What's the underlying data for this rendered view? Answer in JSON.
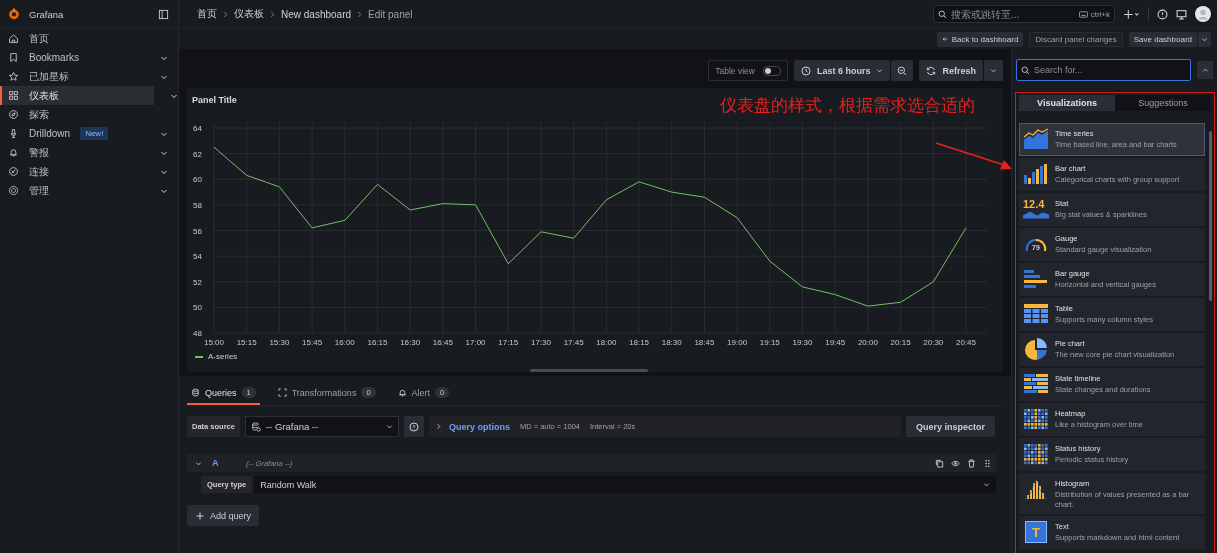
{
  "app": {
    "name": "Grafana"
  },
  "breadcrumbs": [
    {
      "label": "首页",
      "current": false
    },
    {
      "label": "仪表板",
      "current": false
    },
    {
      "label": "New dashboard",
      "current": false
    },
    {
      "label": "Edit panel",
      "current": true
    }
  ],
  "search": {
    "placeholder": "搜索或跳转至...",
    "shortcut": "ctrl+k"
  },
  "sidebar": {
    "items": [
      {
        "label": "首页",
        "selected": false,
        "submenu": false
      },
      {
        "label": "Bookmarks",
        "selected": false,
        "submenu": true
      },
      {
        "label": "已加星标",
        "selected": false,
        "submenu": true
      },
      {
        "label": "仪表板",
        "selected": true,
        "submenu": true
      },
      {
        "label": "探索",
        "selected": false,
        "submenu": false
      },
      {
        "label": "Drilldown",
        "selected": false,
        "submenu": true,
        "badge": "New!"
      },
      {
        "label": "警报",
        "selected": false,
        "submenu": true
      },
      {
        "label": "连接",
        "selected": false,
        "submenu": true
      },
      {
        "label": "管理",
        "selected": false,
        "submenu": true
      }
    ]
  },
  "actions": [
    {
      "label": "Back to dashboard",
      "kind": "back"
    },
    {
      "label": "Discard panel changes",
      "kind": "plain"
    },
    {
      "label": "Save dashboard",
      "kind": "split"
    }
  ],
  "toolbar": {
    "table_view": {
      "label": "Table view",
      "on": false
    },
    "time_range": "Last 6 hours",
    "refresh": "Refresh"
  },
  "panel": {
    "title": "Panel Title",
    "chart_data": {
      "type": "line",
      "grid": true,
      "x": [
        "15:00",
        "15:15",
        "15:30",
        "15:45",
        "16:00",
        "16:15",
        "16:30",
        "16:45",
        "17:00",
        "17:15",
        "17:30",
        "17:45",
        "18:00",
        "18:15",
        "18:30",
        "18:45",
        "19:00",
        "19:15",
        "19:30",
        "19:45",
        "20:00",
        "20:15",
        "20:30",
        "20:45"
      ],
      "series": [
        {
          "name": "A-series",
          "color": "#73bf69",
          "values": [
            62.5,
            60.3,
            59.4,
            56.2,
            56.8,
            59.6,
            57.6,
            58.1,
            58.0,
            53.4,
            55.9,
            55.4,
            58.4,
            59.8,
            59.0,
            58.6,
            57.0,
            53.6,
            51.6,
            51.0,
            50.1,
            50.4,
            52.0,
            56.2
          ]
        }
      ],
      "ylim": [
        48,
        64
      ],
      "yticks": [
        48,
        50,
        52,
        54,
        56,
        58,
        60,
        62,
        64
      ]
    }
  },
  "query_tabs": [
    {
      "label": "Queries",
      "count": "1",
      "selected": true
    },
    {
      "label": "Transformations",
      "count": "0",
      "selected": false
    },
    {
      "label": "Alert",
      "count": "0",
      "selected": false
    }
  ],
  "data_source": {
    "label": "Data source",
    "value": "-- Grafana --"
  },
  "query_options": {
    "label": "Query options",
    "details": [
      "MD = auto = 1004",
      "Interval = 20s"
    ]
  },
  "query_inspector": "Query inspector",
  "queries": [
    {
      "name": "A",
      "source": "(-- Grafana --)",
      "expanded": true,
      "type_label": "Query type",
      "type_value": "Random Walk"
    }
  ],
  "add_query": "Add query",
  "viz_search": {
    "placeholder": "Search for..."
  },
  "viz_tabs": [
    {
      "label": "Visualizations",
      "selected": true
    },
    {
      "label": "Suggestions",
      "selected": false
    }
  ],
  "visualizations": [
    {
      "kind": "timeseries",
      "name": "Time series",
      "description": "Time based line, area and bar charts",
      "selected": true
    },
    {
      "kind": "barchart",
      "name": "Bar chart",
      "description": "Categorical charts with group support",
      "selected": false
    },
    {
      "kind": "stat",
      "name": "Stat",
      "description": "Big stat values & sparklines",
      "selected": false,
      "icon_text": "12.4"
    },
    {
      "kind": "gauge",
      "name": "Gauge",
      "description": "Standard gauge visualization",
      "selected": false,
      "icon_text": "79"
    },
    {
      "kind": "bargauge",
      "name": "Bar gauge",
      "description": "Horizontal and vertical gauges",
      "selected": false
    },
    {
      "kind": "table",
      "name": "Table",
      "description": "Supports many column styles",
      "selected": false
    },
    {
      "kind": "pie",
      "name": "Pie chart",
      "description": "The new core pie chart visualization",
      "selected": false
    },
    {
      "kind": "statetimeline",
      "name": "State timeline",
      "description": "State changes and durations",
      "selected": false
    },
    {
      "kind": "heatmap",
      "name": "Heatmap",
      "description": "Like a histogram over time",
      "selected": false
    },
    {
      "kind": "statushistory",
      "name": "Status history",
      "description": "Periodic status history",
      "selected": false
    },
    {
      "kind": "histogram",
      "name": "Histogram",
      "description": "Distribution of values presented as a bar chart.",
      "selected": false
    },
    {
      "kind": "text",
      "name": "Text",
      "description": "Supports markdown and html content",
      "selected": false,
      "icon_text": "T"
    }
  ],
  "annotation": {
    "text": "仪表盘的样式，根据需求选合适的"
  }
}
